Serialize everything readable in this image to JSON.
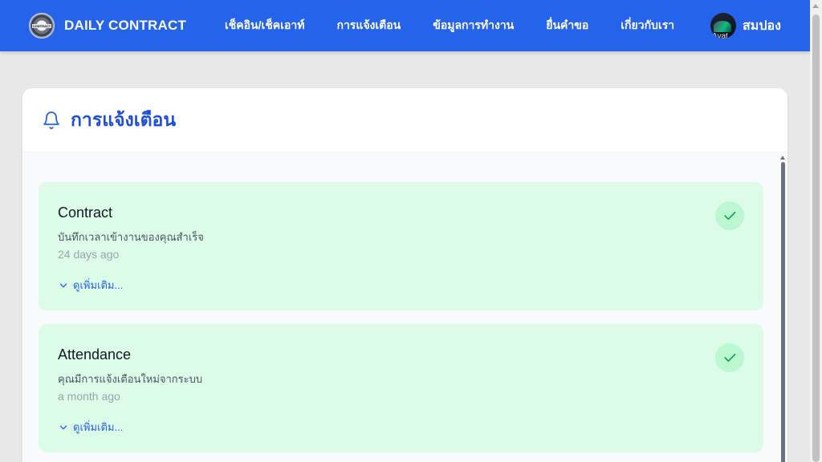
{
  "brand": {
    "title": "DAILY CONTRACT",
    "logo_text": "CONTRACT"
  },
  "nav": {
    "items": [
      {
        "label": "เช็คอิน/เช็คเอาท์"
      },
      {
        "label": "การแจ้งเตือน"
      },
      {
        "label": "ข้อมูลการทำงาน"
      },
      {
        "label": "ยื่นคำขอ"
      },
      {
        "label": "เกี่ยวกับเรา"
      }
    ]
  },
  "user": {
    "name": "สมปอง",
    "avatar_alt": "Avat"
  },
  "page": {
    "title": "การแจ้งเตือน",
    "icon": "bell-icon"
  },
  "notifications": [
    {
      "title": "Contract",
      "message": "บันทึกเวลาเข้างานของคุณสำเร็จ",
      "time": "24 days ago",
      "more_label": "ดูเพิ่มเติม...",
      "status_icon": "check-icon"
    },
    {
      "title": "Attendance",
      "message": "คุณมีการแจ้งเตือนใหม่จากระบบ",
      "time": "a month ago",
      "more_label": "ดูเพิ่มเติม...",
      "status_icon": "check-icon"
    }
  ],
  "colors": {
    "nav_bg": "#2563eb",
    "title_blue": "#1d4ed8",
    "card_green": "#dcfce7",
    "check_green": "#16a34a"
  }
}
